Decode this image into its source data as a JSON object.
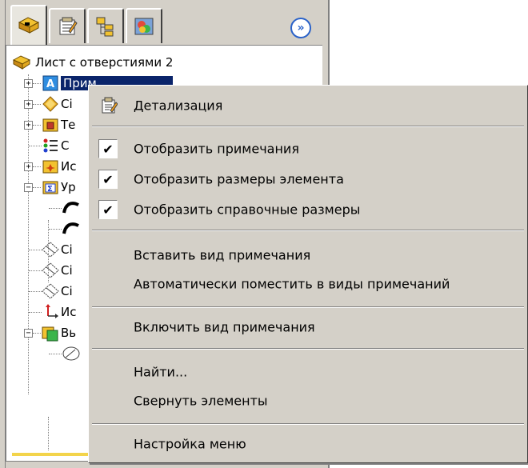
{
  "panel": {
    "tabs": [
      {
        "icon": "feature-tree-icon"
      },
      {
        "icon": "property-manager-icon"
      },
      {
        "icon": "configuration-manager-icon"
      },
      {
        "icon": "appearance-manager-icon"
      }
    ],
    "expand_label": "»",
    "tree": {
      "root": {
        "label": "Лист с отверстиями 2",
        "icon": "part-icon"
      },
      "items": [
        {
          "label": "Прим",
          "icon": "annotations-icon"
        },
        {
          "label": "Сі",
          "icon": "material-icon"
        },
        {
          "label": "Те",
          "icon": "solid-bodies-icon"
        },
        {
          "label": "С",
          "icon": "equations-icon"
        },
        {
          "label": "Ис",
          "icon": "lights-icon"
        },
        {
          "label": "Ур",
          "icon": "sum-folder-icon"
        },
        {
          "label": "",
          "icon": "sketch-curve-icon"
        },
        {
          "label": "",
          "icon": "sketch-curve-icon"
        },
        {
          "label": "Сі",
          "icon": "plane-icon"
        },
        {
          "label": "Сі",
          "icon": "plane-icon"
        },
        {
          "label": "Сі",
          "icon": "plane-icon"
        },
        {
          "label": "Ис",
          "icon": "origin-icon"
        },
        {
          "label": "Вь",
          "icon": "extrude-icon"
        },
        {
          "label": "",
          "icon": "sketch-icon"
        }
      ]
    }
  },
  "menu": {
    "items": [
      {
        "label": "Детализация",
        "icon": "details-icon"
      },
      {
        "label": "Отобразить примечания",
        "checked": true
      },
      {
        "label": "Отобразить размеры элемента",
        "checked": true
      },
      {
        "label": "Отобразить справочные размеры",
        "checked": true
      },
      {
        "label": "Вставить вид примечания"
      },
      {
        "label": "Автоматически поместить в виды примечаний"
      },
      {
        "label": "Включить вид примечания"
      },
      {
        "label": "Найти..."
      },
      {
        "label": "Свернуть элементы"
      },
      {
        "label": "Настройка меню"
      }
    ],
    "check_glyph": "✔"
  },
  "colors": {
    "chrome": "#d4d0c8",
    "selection": "#0a246a",
    "accent_blue": "#2a62c9"
  }
}
